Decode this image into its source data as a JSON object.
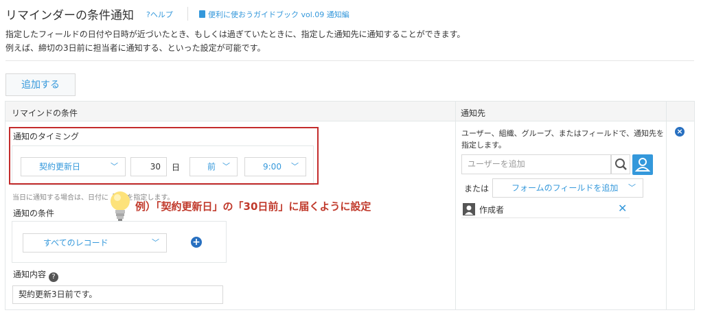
{
  "header": {
    "title": "リマインダーの条件通知",
    "help_link": "?ヘルプ",
    "guide_link": "便利に使おうガイドブック vol.09 通知編"
  },
  "description": {
    "line1": "指定したフィールドの日付や日時が近づいたとき、もしくは過ぎていたときに、指定した通知先に通知することができます。",
    "line2": "例えば、締切の3日前に担当者に通知する、といった設定が可能です。"
  },
  "add_button": "追加する",
  "table": {
    "col_condition": "リマインドの条件",
    "col_recipient": "通知先"
  },
  "timing": {
    "label": "通知のタイミング",
    "field": "契約更新日",
    "days": "30",
    "days_unit": "日",
    "direction": "前",
    "time": "9:00",
    "note": "当日に通知する場合は、日付に「0」を指定します。"
  },
  "callout": "例）「契約更新日」の「30日前」に届くように設定",
  "condition": {
    "label": "通知の条件",
    "filter": "すべてのレコード"
  },
  "content": {
    "label": "通知内容",
    "value": "契約更新3日前です。"
  },
  "recipient": {
    "desc_line1": "ユーザー、組織、グループ、またはフィールドで、通知先を",
    "desc_line2": "指定します。",
    "user_input_placeholder": "ユーザーを追加",
    "or_label": "または",
    "field_add_button": "フォームのフィールドを追加",
    "entry_name": "作成者"
  },
  "colors": {
    "accent": "#3498db",
    "highlight": "#c32b2b",
    "callout_text": "#c0392b"
  }
}
